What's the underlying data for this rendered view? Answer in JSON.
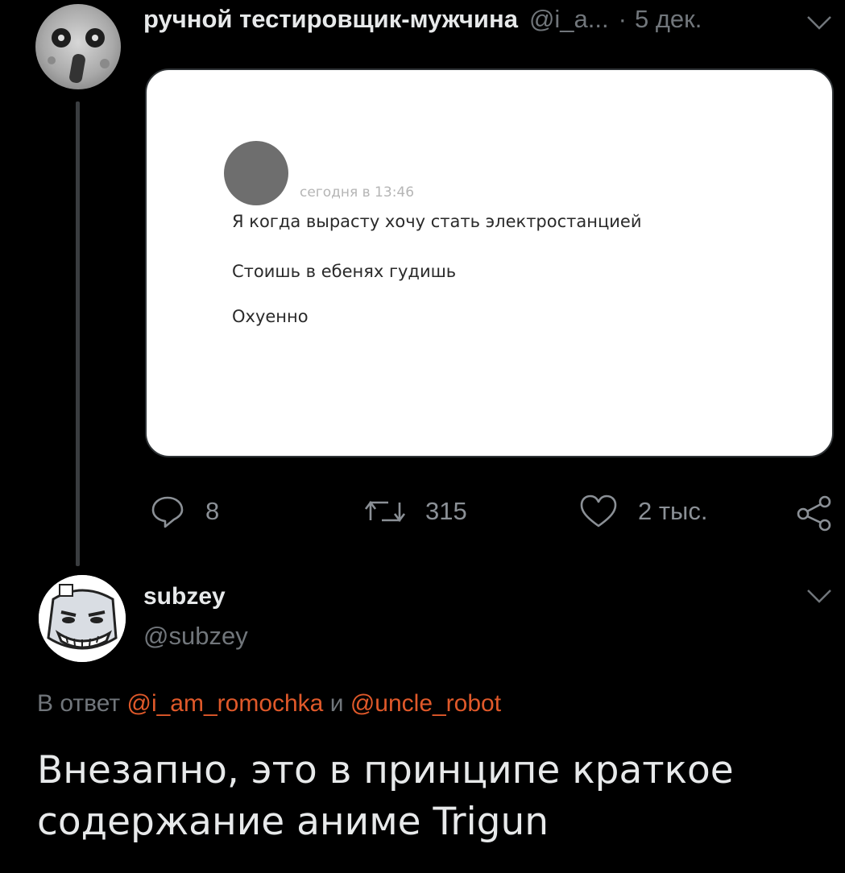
{
  "tweet1": {
    "name": "ручной тестировщик-мужчина",
    "handle": "@i_a...",
    "separator": "·",
    "date": "5 дек.",
    "card": {
      "time": "сегодня в 13:46",
      "lines": [
        "Я когда вырасту хочу стать электростанцией",
        "Стоишь в ебенях гудишь",
        "Охуенно"
      ]
    },
    "actions": {
      "reply_count": "8",
      "retweet_count": "315",
      "like_count": "2 тыс."
    }
  },
  "tweet2": {
    "name": "subzey",
    "handle": "@subzey",
    "reply_prefix": "В ответ",
    "mention1": "@i_am_romochka",
    "conjunction": "и",
    "mention2": "@uncle_robot",
    "text": "Внезапно, это в принципе краткое содержание аниме Trigun"
  },
  "colors": {
    "background": "#000000",
    "text_primary": "#e7e9ea",
    "text_secondary": "#71767b",
    "mention": "#e0592a",
    "thread_line": "#3a3d40"
  }
}
